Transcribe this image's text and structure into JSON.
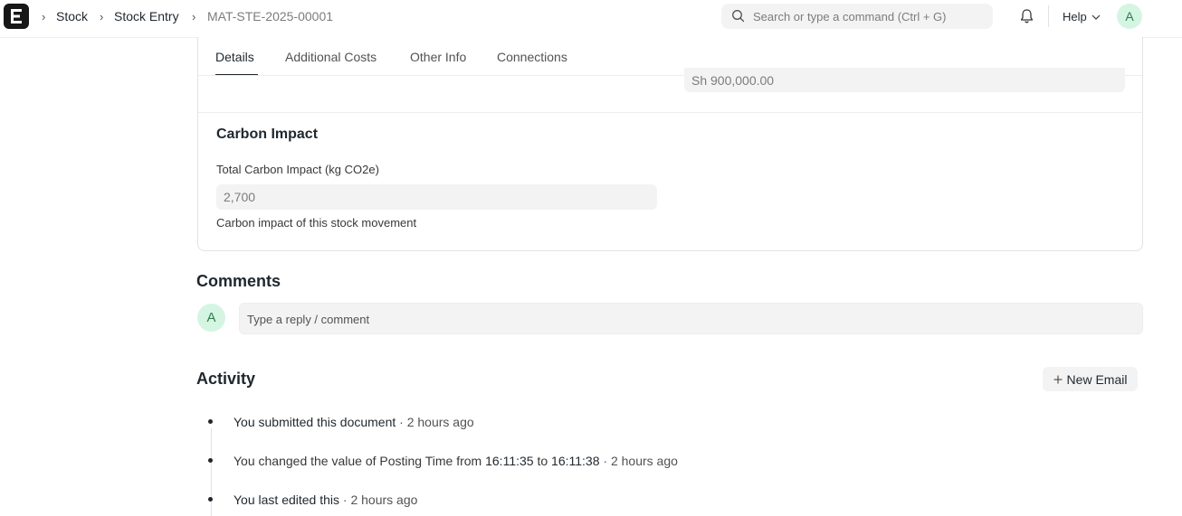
{
  "navbar": {
    "logo_letter": "E",
    "breadcrumbs": [
      "Stock",
      "Stock Entry",
      "MAT-STE-2025-00001"
    ],
    "search_placeholder": "Search or type a command (Ctrl + G)",
    "help_label": "Help",
    "avatar_initial": "A"
  },
  "form": {
    "tabs": [
      {
        "label": "Details",
        "active": true
      },
      {
        "label": "Additional Costs",
        "active": false
      },
      {
        "label": "Other Info",
        "active": false
      },
      {
        "label": "Connections",
        "active": false
      }
    ],
    "previous_field_value": "Sh 900,000.00",
    "section_title": "Carbon Impact",
    "field_label": "Total Carbon Impact (kg CO2e)",
    "field_value": "2,700",
    "field_description": "Carbon impact of this stock movement"
  },
  "comments": {
    "title": "Comments",
    "avatar_initial": "A",
    "placeholder": "Type a reply / comment"
  },
  "activity": {
    "title": "Activity",
    "new_email_label": "New Email",
    "items": [
      {
        "text": "You submitted this document",
        "time": "· 2 hours ago"
      },
      {
        "prefix": "You changed the value of Posting Time from ",
        "from": "16:11:35",
        "mid": " to ",
        "to": "16:11:38",
        "time": "· 2 hours ago"
      },
      {
        "text": "You last edited this",
        "time": "· 2 hours ago"
      }
    ]
  },
  "colors": {
    "accent_avatar_bg": "#d5f5e3",
    "accent_avatar_text": "#2f7d4f",
    "logo_bg": "#171717"
  }
}
